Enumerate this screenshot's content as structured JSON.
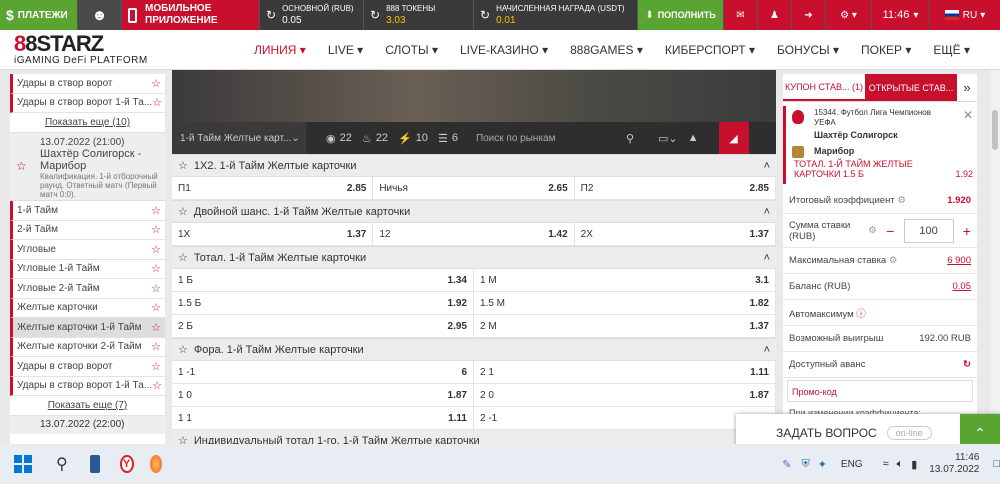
{
  "topbar": {
    "payments": "ПЛАТЕЖИ",
    "mobile_app": "МОБИЛЬНОЕ ПРИЛОЖЕНИЕ",
    "main_account_label": "ОСНОВНОЙ (RUB)",
    "main_account_value": "0.05",
    "tokens_label": "888 ТОКЕНЫ",
    "tokens_value": "3.03",
    "reward_label": "НАЧИСЛЕННАЯ НАГРАДА (USDT)",
    "reward_value": "0.01",
    "deposit": "ПОПОЛНИТЬ",
    "time": "11:46",
    "lang": "RU"
  },
  "logo": {
    "main": "8STARZ",
    "sub": "iGAMING DeFi PLATFORM"
  },
  "nav": [
    "ЛИНИЯ",
    "LIVE",
    "СЛОТЫ",
    "LIVE-КАЗИНО",
    "888GAMES",
    "КИБЕРСПОРТ",
    "БОНУСЫ",
    "ПОКЕР",
    "ЕЩЁ"
  ],
  "left": {
    "items_top": [
      "Удары в створ ворот",
      "Удары в створ ворот 1-й Та..."
    ],
    "more1": "Показать еще (10)",
    "match": {
      "date": "13.07.2022 (21:00)",
      "teams": "Шахтёр Солигорск - Марибор",
      "note": "Квалификация. 1-й отборочный раунд. Ответный матч (Первый матч 0:0)."
    },
    "items": [
      "1-й Тайм",
      "2-й Тайм",
      "Угловые",
      "Угловые 1-й Тайм",
      "Угловые 2-й Тайм",
      "Желтые карточки",
      "Желтые карточки 1-й Тайм",
      "Желтые карточки 2-й Тайм",
      "Удары в створ ворот",
      "Удары в створ ворот 1-й Та..."
    ],
    "selected_index": 6,
    "more2": "Показать еще (7)",
    "date2": "13.07.2022 (22:00)"
  },
  "center": {
    "filter": {
      "select": "1-й Тайм Желтые карт...",
      "c1": "22",
      "c2": "22",
      "c3": "10",
      "c4": "6",
      "search_placeholder": "Поиск по рынкам"
    },
    "groups": [
      {
        "title": "1X2. 1-й Тайм Желтые карточки",
        "rows": [
          [
            [
              "П1",
              "2.85"
            ],
            [
              "Ничья",
              "2.65"
            ],
            [
              "П2",
              "2.85"
            ]
          ]
        ]
      },
      {
        "title": "Двойной шанс. 1-й Тайм Желтые карточки",
        "rows": [
          [
            [
              "1X",
              "1.37"
            ],
            [
              "12",
              "1.42"
            ],
            [
              "2X",
              "1.37"
            ]
          ]
        ]
      },
      {
        "title": "Тотал. 1-й Тайм Желтые карточки",
        "rows": [
          [
            [
              "1 Б",
              "1.34"
            ],
            [
              "1 М",
              "3.1"
            ]
          ],
          [
            [
              "1.5 Б",
              "1.92"
            ],
            [
              "1.5 М",
              "1.82"
            ]
          ],
          [
            [
              "2 Б",
              "2.95"
            ],
            [
              "2 М",
              "1.37"
            ]
          ]
        ]
      },
      {
        "title": "Фора. 1-й Тайм Желтые карточки",
        "rows": [
          [
            [
              "1 -1",
              "6"
            ],
            [
              "2 1",
              "1.11"
            ]
          ],
          [
            [
              "1 0",
              "1.87"
            ],
            [
              "2 0",
              "1.87"
            ]
          ],
          [
            [
              "1 1",
              "1.11"
            ],
            [
              "2 -1",
              "6"
            ]
          ]
        ]
      }
    ],
    "next_group": "Индивидуальный тотал 1-го. 1-й Тайм Желтые карточки"
  },
  "coupon": {
    "tab1": "КУПОН СТАВ...",
    "tab1_count": "(1)",
    "tab2": "ОТКРЫТЫЕ СТАВ...",
    "bet_header": "15344. Футбол Лига Чемпионов УЕФА",
    "team1": "Шахтёр Солигорск",
    "team2": "Марибор",
    "bet_name": "ТОТАЛ. 1-Й ТАЙМ ЖЕЛТЫЕ КАРТОЧКИ 1.5 Б",
    "bet_odds": "1.92",
    "total_odds_label": "Итоговый коэффициент",
    "total_odds": "1.920",
    "stake_label": "Сумма ставки (RUB)",
    "stake": "100",
    "max_label": "Максимальная ставка",
    "max_value": "6 900",
    "balance_label": "Баланс (RUB)",
    "balance_value": "0.05",
    "automax_label": "Автомаксимум",
    "win_label": "Возможный выигрыш",
    "win_value": "192.00 RUB",
    "advance_label": "Доступный аванс",
    "promo_placeholder": "Промо-код",
    "change_label": "При изменении коэффициента:"
  },
  "ask": {
    "label": "ЗАДАТЬ ВОПРОС",
    "status": "on-line"
  },
  "taskbar": {
    "lang": "ENG",
    "time": "11:46",
    "date": "13.07.2022"
  },
  "colors": {
    "accent": "#c8102e",
    "green": "#5aa531",
    "dark": "#3a3a3a"
  }
}
